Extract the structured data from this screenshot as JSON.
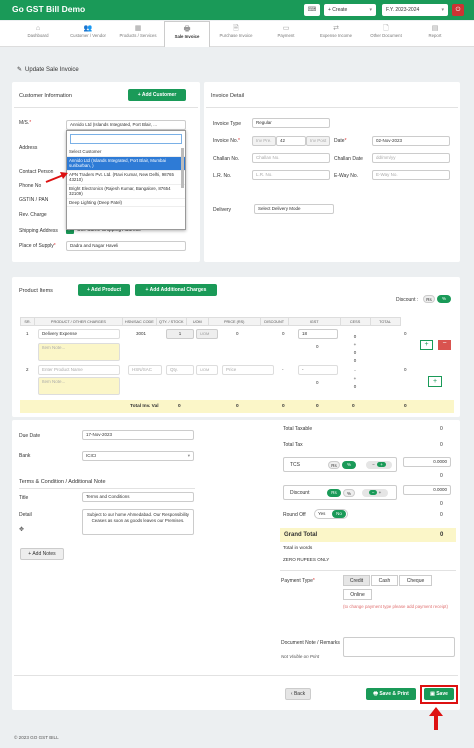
{
  "app": {
    "title": "Go GST Bill Demo",
    "keyboard_icon": "⌨",
    "create_label": "+ Create",
    "fy_label": "F.Y. 2023-2024"
  },
  "nav": [
    {
      "label": "Dashboard",
      "icon": "⌂"
    },
    {
      "label": "Customer / Vendor",
      "icon": "👥"
    },
    {
      "label": "Products / Services",
      "icon": "▦"
    },
    {
      "label": "Sale Invoice",
      "icon": "🖶"
    },
    {
      "label": "Purchase Invoice",
      "icon": "🗎"
    },
    {
      "label": "Payment",
      "icon": "▭"
    },
    {
      "label": "Expense Income",
      "icon": "⇄"
    },
    {
      "label": "Other Document",
      "icon": "🗋"
    },
    {
      "label": "Report",
      "icon": "▤"
    }
  ],
  "page_title": "Update Sale Invoice",
  "customer": {
    "heading": "Customer Information",
    "add_customer": "+ Add Customer",
    "ms_label": "M/S.",
    "ms_value": "Annido Ltd (Islands Integrated, Port Blair, ...",
    "address_label": "Address",
    "contact_label": "Contact Person",
    "phone_label": "Phone No",
    "gstin_label": "GSTIN / PAN",
    "rev_label": "Rev. Charge",
    "ship_label": "Shipping Address",
    "same_ship": "Use Same Shipping Address",
    "pos_label": "Place of Supply",
    "pos_value": "Dadra and Nagar Haveli",
    "dropdown": {
      "placeholder": "Select Customer",
      "options": [
        "Annido Ltd (Islands Integrated, Port Blair, Mumbai suriburban, )",
        "APN Traders Pvt. Ltd. (Ravi Kumar, New Delhi, 98765 43210)",
        "Bright Electronics (Rajesh Kumar, Bangalore, 87654 32109)",
        "Deep Lighting (Deep Patel)"
      ]
    }
  },
  "invoice": {
    "heading": "Invoice Detail",
    "type_label": "Invoice Type",
    "type_value": "Regular",
    "no_label": "Invoice No.",
    "no_prefix": "Inv Pre.",
    "no_value": "42",
    "no_suffix": "Inv Post",
    "date_label": "Date",
    "date_value": "02-Nov-2023",
    "challan_label": "Challan No.",
    "challan_ph": "Challan No.",
    "challan_date_label": "Challan Date",
    "challan_date_ph": "dd/mm/yy",
    "lr_label": "L.R. No.",
    "lr_ph": "L.R. No.",
    "eway_label": "E-Way No.",
    "eway_ph": "E-Way No.",
    "delivery_label": "Delivery",
    "delivery_value": "Select Delivery Mode"
  },
  "products": {
    "heading": "Product Items",
    "add_product": "+ Add Product",
    "add_charges": "+ Add Additional Charges",
    "discount_label": "Discount :",
    "discount_opt1": "Rs",
    "discount_opt2": "%",
    "headers": [
      "SR.",
      "PRODUCT / OTHER CHARGES",
      "HSN/SAC CODE",
      "QTY. / STOCK",
      "UOM",
      "PRICE (RS)",
      "DISCOUNT",
      "IGST",
      "CESS",
      "TOTAL"
    ],
    "rows": [
      {
        "sr": "1",
        "name": "Delivery Expense",
        "note": "Item Note...",
        "hsn": "3001",
        "qty": "1",
        "uom": "UOM",
        "price": "0",
        "disc": "0",
        "igst": "18",
        "igst_amt": "0",
        "cess": "0",
        "total": "0"
      },
      {
        "sr": "2",
        "name": "Enter Product Name",
        "note": "Item Note...",
        "hsn": "HSN/SAC",
        "qty": "Qty.",
        "uom": "UOM",
        "price": "Price",
        "disc": "-",
        "igst": "-",
        "igst_amt": "0",
        "cess": "-",
        "total": "0"
      }
    ],
    "total_row": {
      "label": "Total Inv. Val",
      "qty": "0",
      "price": "0",
      "disc": "0",
      "igst": "0",
      "cess": "0",
      "total": "0"
    }
  },
  "footer": {
    "due_label": "Due Date",
    "due_value": "17-Nov-2023",
    "bank_label": "Bank",
    "bank_value": "ICICI",
    "terms_heading": "Terms & Condition / Additional Note",
    "title_label": "Title",
    "title_value": "Terms and Conditions",
    "detail_label": "Detail",
    "detail_value": "Subject to our home Ahmedabad. Our Responsibility Ceases as soon as goods leaves our Premises.",
    "add_notes": "+ Add Notes",
    "total_taxable_label": "Total Taxable",
    "total_taxable": "0",
    "total_tax_label": "Total Tax",
    "total_tax": "0",
    "tcs_label": "TCS",
    "tcs_value": "0.0000",
    "tcs_amt": "0",
    "discount_label": "Discount",
    "discount_value": "0.0000",
    "discount_amt": "0",
    "round_label": "Round Off",
    "round_yes": "Yes",
    "round_no": "No",
    "round_amt": "0",
    "grand_label": "Grand Total",
    "grand_value": "0",
    "words_label": "Total in words",
    "words_value": "ZERO RUPEES ONLY",
    "pay_label": "Payment Type",
    "pay_options": [
      "Credit",
      "Cash",
      "Cheque",
      "Online"
    ],
    "pay_note": "(to change payment type please add payment receipt)",
    "doc_label": "Document Note / Remarks",
    "doc_sub": "Not Visible on Print",
    "back": "Back",
    "save_print": "Save & Print",
    "save": "Save"
  },
  "copyright": "© 2023 GO GST BILL",
  "colors": {
    "brand": "#1a9a58",
    "highlight": "#d11111",
    "select": "#2e7bd6"
  }
}
